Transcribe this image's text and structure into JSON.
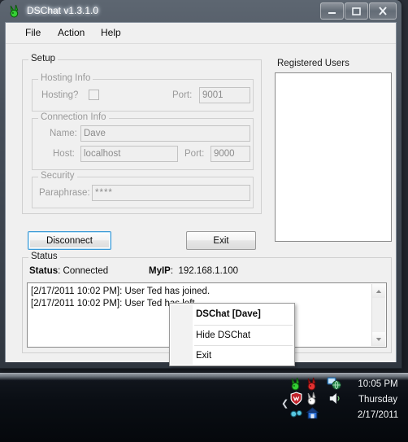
{
  "window": {
    "title": "DSChat v1.3.1.0",
    "icon": "rabbit-green-icon",
    "buttons": {
      "minimize": "minimize-icon",
      "maximize": "maximize-icon",
      "close": "close-icon"
    }
  },
  "menubar": {
    "items": [
      {
        "label": "File"
      },
      {
        "label": "Action"
      },
      {
        "label": "Help"
      }
    ]
  },
  "setup": {
    "legend": "Setup",
    "hosting": {
      "legend": "Hosting Info",
      "hosting_label": "Hosting?",
      "hosting_checked": false,
      "port_label": "Port:",
      "port_value": "9001"
    },
    "connection": {
      "legend": "Connection Info",
      "name_label": "Name:",
      "name_value": "Dave",
      "host_label": "Host:",
      "host_value": "localhost",
      "port_label": "Port:",
      "port_value": "9000"
    },
    "security": {
      "legend": "Security",
      "paraphrase_label": "Paraphrase:",
      "paraphrase_value": "****"
    },
    "disconnect_label": "Disconnect",
    "exit_label": "Exit"
  },
  "registered_users": {
    "legend": "Registered Users",
    "items": []
  },
  "status": {
    "legend": "Status",
    "status_label": "Status",
    "status_value": "Connected",
    "myip_label": "MyIP",
    "myip_value": "192.168.1.100",
    "log": [
      "[2/17/2011 10:02 PM]: User Ted has joined.",
      "[2/17/2011 10:02 PM]: User Ted has left."
    ],
    "scroll_up_icon": "scroll-up-arrow-icon",
    "scroll_down_icon": "scroll-down-arrow-icon"
  },
  "context_menu": {
    "items": [
      {
        "label": "DSChat [Dave]",
        "bold": true
      },
      {
        "label": "Hide DSChat",
        "bold": false
      },
      {
        "label": "Exit",
        "bold": false
      }
    ]
  },
  "taskbar": {
    "tray_expand_icon": "chevron-left-icon",
    "tray_icons": [
      "rabbit-green-icon",
      "rabbit-red-icon",
      "network-globe-icon",
      "mcafee-shield-icon",
      "rabbit-white-icon",
      "speaker-volume-icon",
      "glasses-icon",
      "blue-figure-icon"
    ],
    "clock": {
      "time": "10:05 PM",
      "day": "Thursday",
      "date": "2/17/2011"
    }
  },
  "colors": {
    "accent": "#3c9ad6",
    "window_chrome": "#474f5a",
    "client_bg": "#f0f0f0"
  }
}
